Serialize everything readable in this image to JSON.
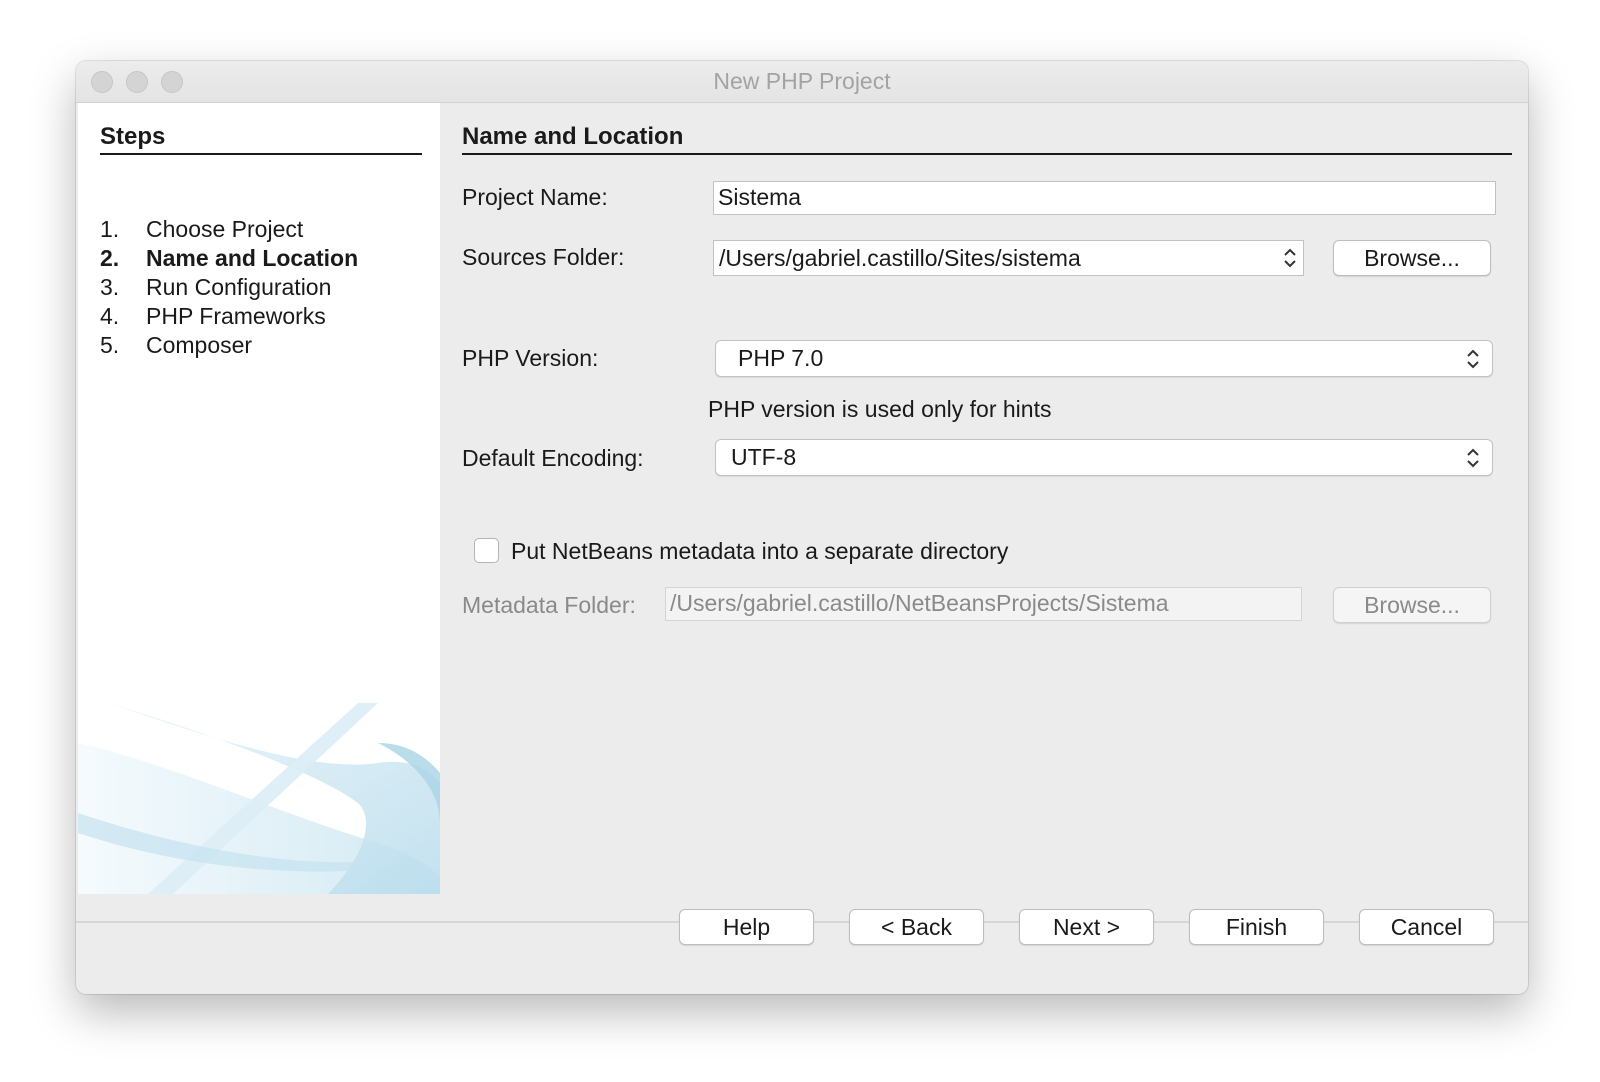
{
  "window": {
    "title": "New PHP Project"
  },
  "steps": {
    "heading": "Steps",
    "items": [
      {
        "num": "1.",
        "label": "Choose Project"
      },
      {
        "num": "2.",
        "label": "Name and Location"
      },
      {
        "num": "3.",
        "label": "Run Configuration"
      },
      {
        "num": "4.",
        "label": "PHP Frameworks"
      },
      {
        "num": "5.",
        "label": "Composer"
      }
    ],
    "active_index": 1
  },
  "form": {
    "heading": "Name and Location",
    "project_name": {
      "label": "Project Name:",
      "value": "Sistema"
    },
    "sources_folder": {
      "label": "Sources Folder:",
      "value": "/Users/gabriel.castillo/Sites/sistema",
      "browse_label": "Browse..."
    },
    "php_version": {
      "label": "PHP Version:",
      "value": "PHP 7.0",
      "hint": "PHP version is used only for hints"
    },
    "default_encoding": {
      "label": "Default Encoding:",
      "value": "UTF-8"
    },
    "metadata_checkbox": {
      "label": "Put NetBeans metadata into a separate directory",
      "checked": false
    },
    "metadata_folder": {
      "label": "Metadata Folder:",
      "value": "/Users/gabriel.castillo/NetBeansProjects/Sistema",
      "browse_label": "Browse..."
    }
  },
  "buttons": {
    "help": "Help",
    "back": "< Back",
    "next": "Next >",
    "finish": "Finish",
    "cancel": "Cancel"
  },
  "icons": {
    "close": "close-icon",
    "minimize": "minimize-icon",
    "zoom": "zoom-icon",
    "updown": "chevron-updown-icon"
  }
}
